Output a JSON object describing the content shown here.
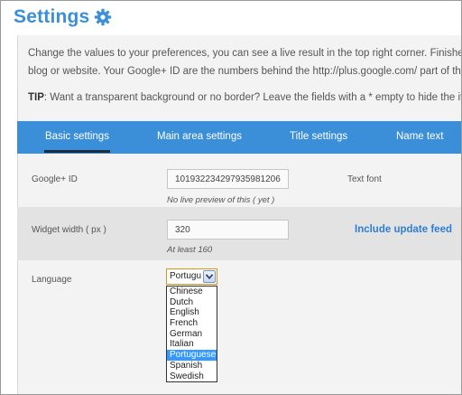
{
  "header": {
    "title": "Settings",
    "icon": "gear-icon"
  },
  "intro": {
    "line1": "Change the values to your preferences, you can see a live result in the top right corner. Finished?",
    "line2": "blog or website. Your Google+ ID are the numbers behind the http://plus.google.com/ part of the url."
  },
  "tip": {
    "label": "TIP",
    "text": ": Want a transparent background or no border? Leave the fields with a * empty to hide the it."
  },
  "tabs": [
    {
      "label": "Basic settings",
      "active": true
    },
    {
      "label": "Main area settings",
      "active": false
    },
    {
      "label": "Title settings",
      "active": false
    },
    {
      "label": "Name text",
      "active": false
    }
  ],
  "form": {
    "google_id": {
      "label": "Google+ ID",
      "value": "101932234297935981206",
      "hint": "No live preview of this ( yet )"
    },
    "text_font": {
      "label": "Text font"
    },
    "widget_width": {
      "label": "Widget width ( px )",
      "value": "320",
      "hint": "At least 160"
    },
    "update_feed": {
      "label": "Include update feed"
    },
    "language": {
      "label": "Language",
      "selected": "Portugu",
      "options": [
        "Chinese",
        "Dutch",
        "English",
        "French",
        "German",
        "Italian",
        "Portuguese",
        "Spanish",
        "Swedish"
      ],
      "highlighted": "Portuguese"
    }
  },
  "colors": {
    "accent": "#3b8fd8",
    "highlight": "#3399ff",
    "tab_underline": "#1d2b3a"
  }
}
